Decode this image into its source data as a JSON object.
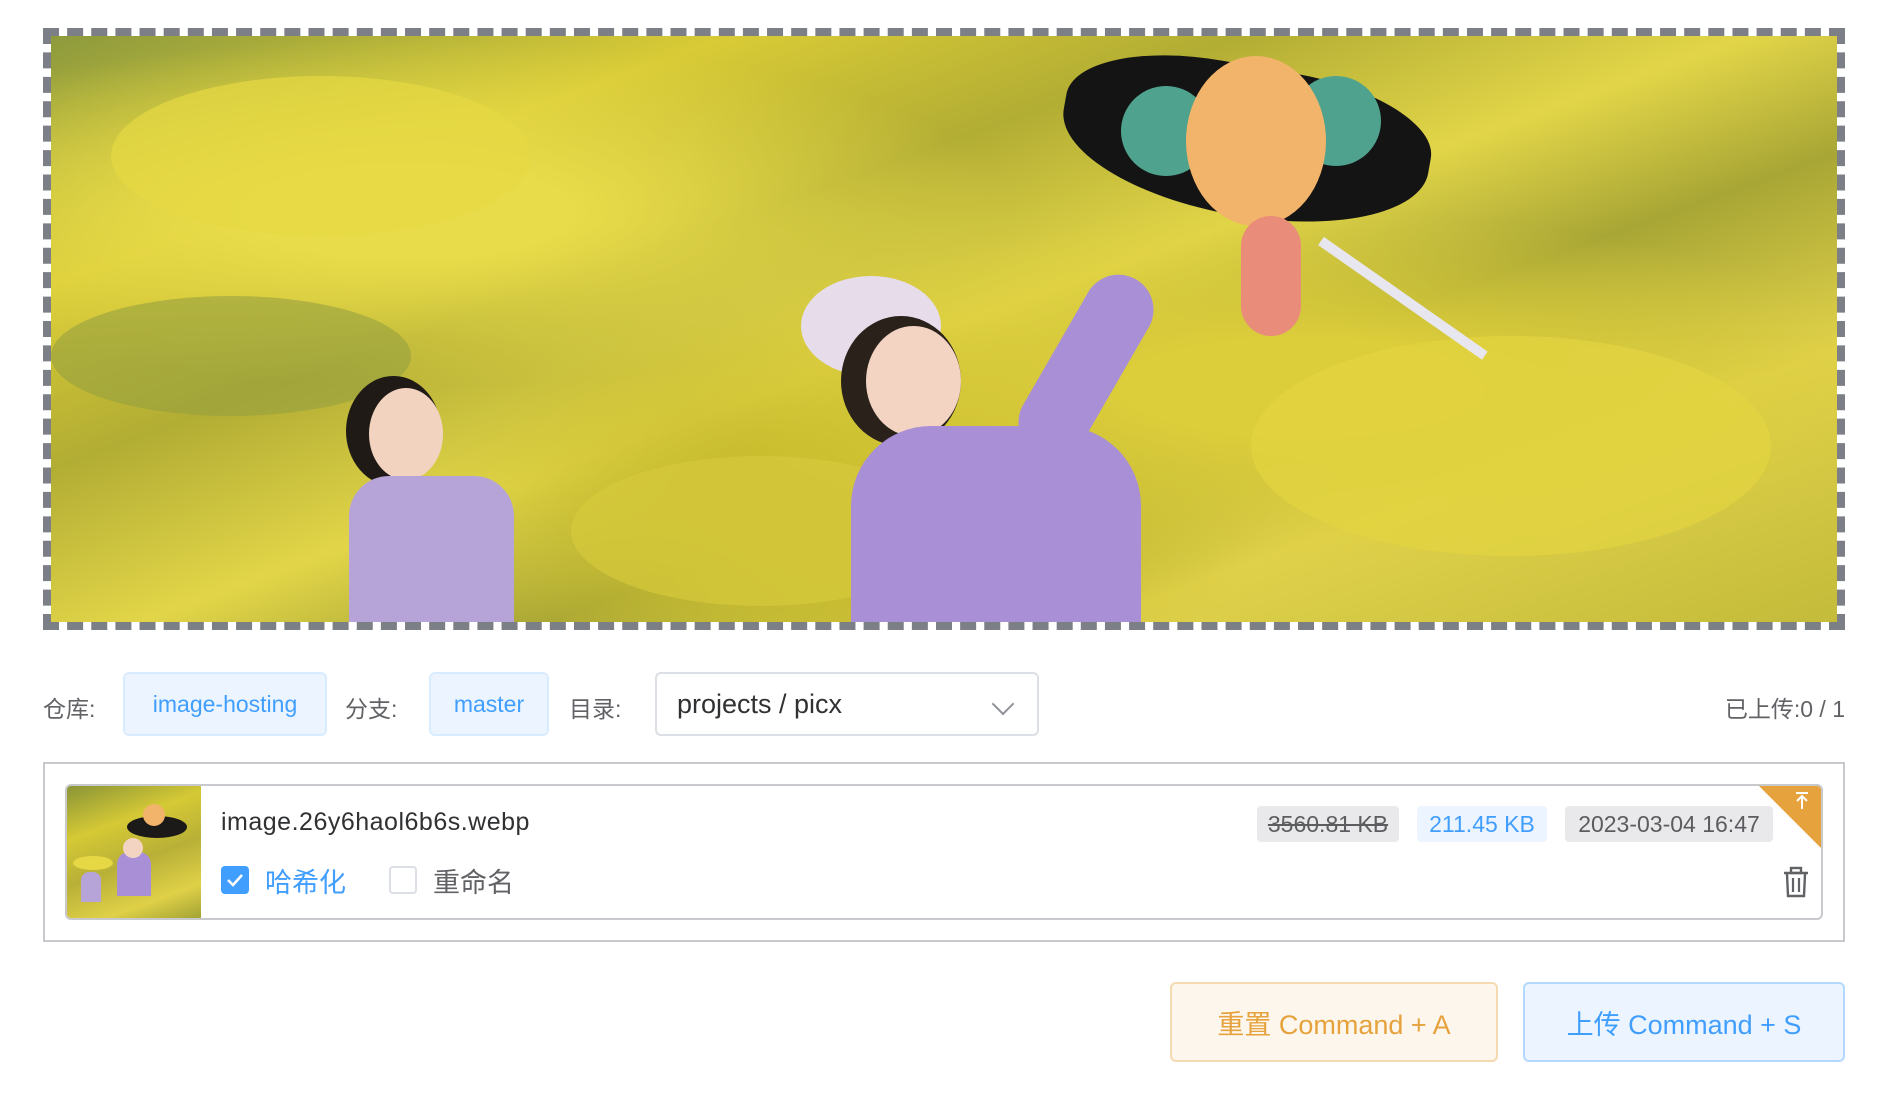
{
  "preview": {
    "alt": "uploaded image preview"
  },
  "settings": {
    "repo_label": "仓库:",
    "repo_value": "image-hosting",
    "branch_label": "分支:",
    "branch_value": "master",
    "dir_label": "目录:",
    "dir_value": "projects / picx",
    "uploaded_label": "已上传:",
    "uploaded_value": "0 / 1"
  },
  "file": {
    "name": "image.26y6haol6b6s.webp",
    "original_size": "3560.81 KB",
    "compressed_size": "211.45 KB",
    "time": "2023-03-04 16:47",
    "hash_label": "哈希化",
    "hash_checked": true,
    "rename_label": "重命名",
    "rename_checked": false,
    "status_icon": "upload-arrow-icon",
    "delete_icon": "trash-icon"
  },
  "actions": {
    "reset_label": "重置 Command + A",
    "upload_label": "上传 Command + S"
  },
  "colors": {
    "primary": "#409eff",
    "warning": "#e6a23c",
    "dashed_border": "#7d7f86"
  }
}
